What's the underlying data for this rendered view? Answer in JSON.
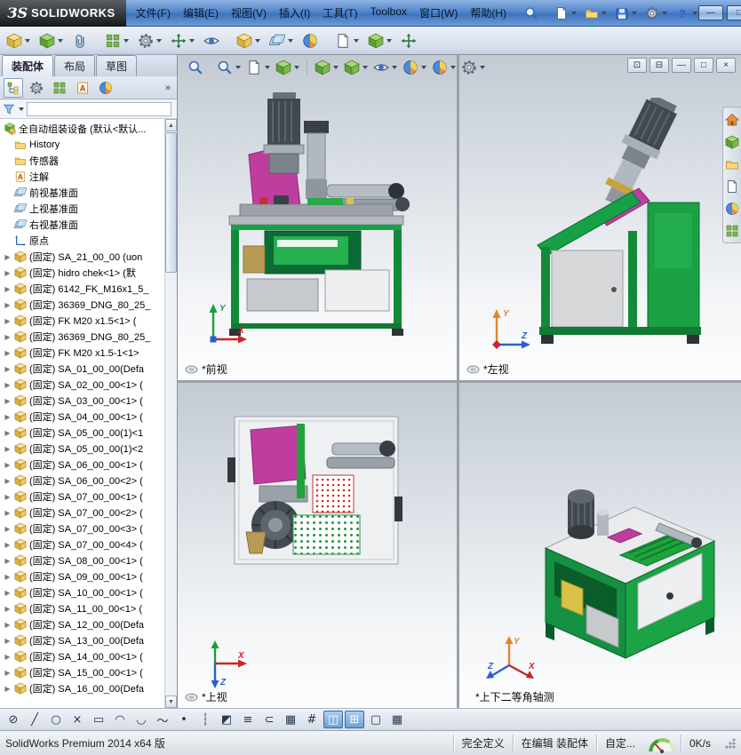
{
  "titlebar": {
    "logo_prefix": "ЗS",
    "logo_text": "SOLIDWORKS",
    "menus": [
      "文件(F)",
      "编辑(E)",
      "视图(V)",
      "插入(I)",
      "工具(T)",
      "Toolbox",
      "窗口(W)",
      "帮助(H)"
    ],
    "quick_tools": [
      {
        "name": "search-button",
        "icon": "mag",
        "caret": false
      },
      {
        "name": "new-document-button",
        "icon": "page",
        "caret": true
      },
      {
        "name": "open-document-button",
        "icon": "folder",
        "caret": true
      },
      {
        "name": "save-document-button",
        "icon": "disk",
        "caret": true
      },
      {
        "name": "options-button",
        "icon": "gear",
        "caret": true
      },
      {
        "name": "help-button",
        "icon": "help",
        "caret": true
      }
    ],
    "window_controls": [
      {
        "name": "minimize-button",
        "glyph": "—"
      },
      {
        "name": "maximize-button",
        "glyph": "□"
      }
    ]
  },
  "assembly_toolbar": [
    {
      "name": "edit-component-button",
      "icon": "cubey",
      "caret": true
    },
    {
      "name": "insert-component-button",
      "icon": "cube",
      "caret": true
    },
    {
      "name": "mate-button",
      "icon": "clip",
      "caret": false
    },
    {
      "name": "linear-component-pattern-button",
      "icon": "grid",
      "caret": true
    },
    {
      "name": "smart-fasteners-button",
      "icon": "gear",
      "caret": true
    },
    {
      "name": "move-component-button",
      "icon": "move",
      "caret": true
    },
    {
      "name": "show-hidden-components-button",
      "icon": "eye",
      "caret": false
    },
    {
      "name": "assembly-features-button",
      "icon": "cubey",
      "caret": true
    },
    {
      "name": "reference-geometry-button",
      "icon": "plane",
      "caret": true
    },
    {
      "name": "new-motion-study-button",
      "icon": "ball",
      "caret": false
    },
    {
      "name": "bill-of-materials-button",
      "icon": "page",
      "caret": true
    },
    {
      "name": "exploded-view-button",
      "icon": "cube",
      "caret": true
    },
    {
      "name": "instant3d-button",
      "icon": "move",
      "caret": false
    }
  ],
  "command_tabs": [
    {
      "name": "tab-assembly",
      "label": "装配体",
      "active": true
    },
    {
      "name": "tab-layout",
      "label": "布局",
      "active": false
    },
    {
      "name": "tab-sketch",
      "label": "草图",
      "active": false
    }
  ],
  "fm_tabs": [
    {
      "name": "featuremanager-tab",
      "icon": "tree",
      "active": true
    },
    {
      "name": "propertymanager-tab",
      "icon": "gear",
      "active": false
    },
    {
      "name": "configurationmanager-tab",
      "icon": "grid",
      "active": false
    },
    {
      "name": "dimxpertmanager-tab",
      "icon": "note",
      "active": false
    },
    {
      "name": "displaymanager-tab",
      "icon": "ball",
      "active": false
    }
  ],
  "fm_tabs_more": "»",
  "tree": {
    "root": {
      "label": "全自动组装设备 (默认<默认..."
    },
    "items": [
      {
        "label": "History",
        "icon": "folder",
        "arrow": false
      },
      {
        "label": "传感器",
        "icon": "folder",
        "arrow": false
      },
      {
        "label": "注解",
        "icon": "note",
        "arrow": false
      },
      {
        "label": "前视基准面",
        "icon": "plane",
        "arrow": false
      },
      {
        "label": "上视基准面",
        "icon": "plane",
        "arrow": false
      },
      {
        "label": "右视基准面",
        "icon": "plane",
        "arrow": false
      },
      {
        "label": "原点",
        "icon": "origin",
        "arrow": false
      },
      {
        "label": "(固定) SA_21_00_00 (uon",
        "icon": "cubey",
        "arrow": true
      },
      {
        "label": "(固定) hidro chek<1> (默",
        "icon": "cubey",
        "arrow": true
      },
      {
        "label": "(固定) 6142_FK_M16x1_5_",
        "icon": "cubey",
        "arrow": true
      },
      {
        "label": "(固定) 36369_DNG_80_25_",
        "icon": "cubey",
        "arrow": true
      },
      {
        "label": "(固定) FK M20 x1.5<1> (",
        "icon": "cubey",
        "arrow": true
      },
      {
        "label": "(固定) 36369_DNG_80_25_",
        "icon": "cubey",
        "arrow": true
      },
      {
        "label": "(固定) FK M20 x1.5-1<1>",
        "icon": "cubey",
        "arrow": true
      },
      {
        "label": "(固定) SA_01_00_00(Defa",
        "icon": "cubey",
        "arrow": true
      },
      {
        "label": "(固定) SA_02_00_00<1> (",
        "icon": "cubey",
        "arrow": true
      },
      {
        "label": "(固定) SA_03_00_00<1> (",
        "icon": "cubey",
        "arrow": true
      },
      {
        "label": "(固定) SA_04_00_00<1> (",
        "icon": "cubey",
        "arrow": true
      },
      {
        "label": "(固定) SA_05_00_00(1)<1",
        "icon": "cubey",
        "arrow": true
      },
      {
        "label": "(固定) SA_05_00_00(1)<2",
        "icon": "cubey",
        "arrow": true
      },
      {
        "label": "(固定) SA_06_00_00<1> (",
        "icon": "cubey",
        "arrow": true
      },
      {
        "label": "(固定) SA_06_00_00<2> (",
        "icon": "cubey",
        "arrow": true
      },
      {
        "label": "(固定) SA_07_00_00<1> (",
        "icon": "cubey",
        "arrow": true
      },
      {
        "label": "(固定) SA_07_00_00<2> (",
        "icon": "cubey",
        "arrow": true
      },
      {
        "label": "(固定) SA_07_00_00<3> (",
        "icon": "cubey",
        "arrow": true
      },
      {
        "label": "(固定) SA_07_00_00<4> (",
        "icon": "cubey",
        "arrow": true
      },
      {
        "label": "(固定) SA_08_00_00<1> (",
        "icon": "cubey",
        "arrow": true
      },
      {
        "label": "(固定) SA_09_00_00<1> (",
        "icon": "cubey",
        "arrow": true
      },
      {
        "label": "(固定) SA_10_00_00<1> (",
        "icon": "cubey",
        "arrow": true
      },
      {
        "label": "(固定) SA_11_00_00<1> (",
        "icon": "cubey",
        "arrow": true
      },
      {
        "label": "(固定) SA_12_00_00(Defa",
        "icon": "cubey",
        "arrow": true
      },
      {
        "label": "(固定) SA_13_00_00(Defa",
        "icon": "cubey",
        "arrow": true
      },
      {
        "label": "(固定) SA_14_00_00<1> (",
        "icon": "cubey",
        "arrow": true
      },
      {
        "label": "(固定) SA_15_00_00<1> (",
        "icon": "cubey",
        "arrow": true
      },
      {
        "label": "(固定) SA_16_00_00(Defa",
        "icon": "cubey",
        "arrow": true
      }
    ]
  },
  "headsup_left": [
    {
      "name": "zoom-fit-button",
      "icon": "mag",
      "caret": false
    },
    {
      "name": "zoom-area-button",
      "icon": "mag",
      "caret": true
    },
    {
      "name": "previous-view-button",
      "icon": "page",
      "caret": true
    },
    {
      "name": "section-view-button",
      "icon": "cube",
      "caret": true
    }
  ],
  "headsup_right": [
    {
      "name": "view-orientation-button",
      "icon": "cube",
      "caret": true
    },
    {
      "name": "display-style-button",
      "icon": "cube",
      "caret": true
    },
    {
      "name": "hide-show-items-button",
      "icon": "eye",
      "caret": true
    },
    {
      "name": "edit-appearance-button",
      "icon": "ball",
      "caret": true
    },
    {
      "name": "apply-scene-button",
      "icon": "ball",
      "caret": true
    },
    {
      "name": "view-settings-button",
      "icon": "gear",
      "caret": true
    }
  ],
  "child_window_controls": [
    {
      "name": "viewport-layout-button",
      "glyph": "⊡"
    },
    {
      "name": "viewport-lock-button",
      "glyph": "⊟"
    },
    {
      "name": "minimize-window-button",
      "glyph": "—"
    },
    {
      "name": "restore-window-button",
      "glyph": "□"
    },
    {
      "name": "close-window-button",
      "glyph": "×"
    }
  ],
  "task_pane": [
    {
      "name": "solidworks-resources-tab",
      "icon": "house"
    },
    {
      "name": "design-library-tab",
      "icon": "cube"
    },
    {
      "name": "file-explorer-tab",
      "icon": "folder"
    },
    {
      "name": "view-palette-tab",
      "icon": "page"
    },
    {
      "name": "appearances-scenes-tab",
      "icon": "ball"
    },
    {
      "name": "custom-properties-tab",
      "icon": "grid"
    }
  ],
  "viewports": {
    "front": {
      "label": "*前视"
    },
    "left": {
      "label": "*左视"
    },
    "top": {
      "label": "*上视"
    },
    "iso": {
      "label": "*上下二等角轴测"
    }
  },
  "triads": {
    "front": {
      "up": "Y",
      "right": "X"
    },
    "left": {
      "up": "Y",
      "right": "Z"
    },
    "top": {
      "right": "X",
      "down": "Z"
    },
    "iso": {
      "up": "Y",
      "right": "X",
      "left": "Z"
    }
  },
  "sketch_toolbar": [
    {
      "name": "smart-dimension-button",
      "glyph": "⊘",
      "active": false
    },
    {
      "name": "line-tool-button",
      "glyph": "╱",
      "active": false
    },
    {
      "name": "circle-tool-button",
      "glyph": "○",
      "active": false
    },
    {
      "name": "trim-entities-button",
      "glyph": "×",
      "active": false
    },
    {
      "name": "corner-rectangle-button",
      "glyph": "▭",
      "active": false
    },
    {
      "name": "centerpoint-arc-button",
      "glyph": "◠",
      "active": false
    },
    {
      "name": "tangent-arc-button",
      "glyph": "◡",
      "active": false
    },
    {
      "name": "spline-tool-button",
      "glyph": "～",
      "active": false
    },
    {
      "name": "point-tool-button",
      "glyph": "•",
      "active": false
    },
    {
      "name": "centerline-tool-button",
      "glyph": "┆",
      "active": false
    },
    {
      "name": "mirror-entities-button",
      "glyph": "◩",
      "active": false
    },
    {
      "name": "offset-entities-button",
      "glyph": "≡",
      "active": false
    },
    {
      "name": "convert-entities-button",
      "glyph": "⊂",
      "active": false
    },
    {
      "name": "linear-sketch-pattern-button",
      "glyph": "▦",
      "active": false
    },
    {
      "name": "grid-snap-button",
      "glyph": "#",
      "active": false
    },
    {
      "name": "viewport-two-button",
      "glyph": "◫",
      "active": true
    },
    {
      "name": "viewport-four-button",
      "glyph": "⊞",
      "active": true
    },
    {
      "name": "viewport-single-button",
      "glyph": "▢",
      "active": false
    },
    {
      "name": "viewport-link-button",
      "glyph": "▦",
      "active": false
    }
  ],
  "statusbar": {
    "app_version": "SolidWorks Premium 2014 x64 版",
    "define_status": "完全定义",
    "edit_status": "在编辑 装配体",
    "custom_tab": "自定...",
    "net_speed": "0K/s"
  }
}
